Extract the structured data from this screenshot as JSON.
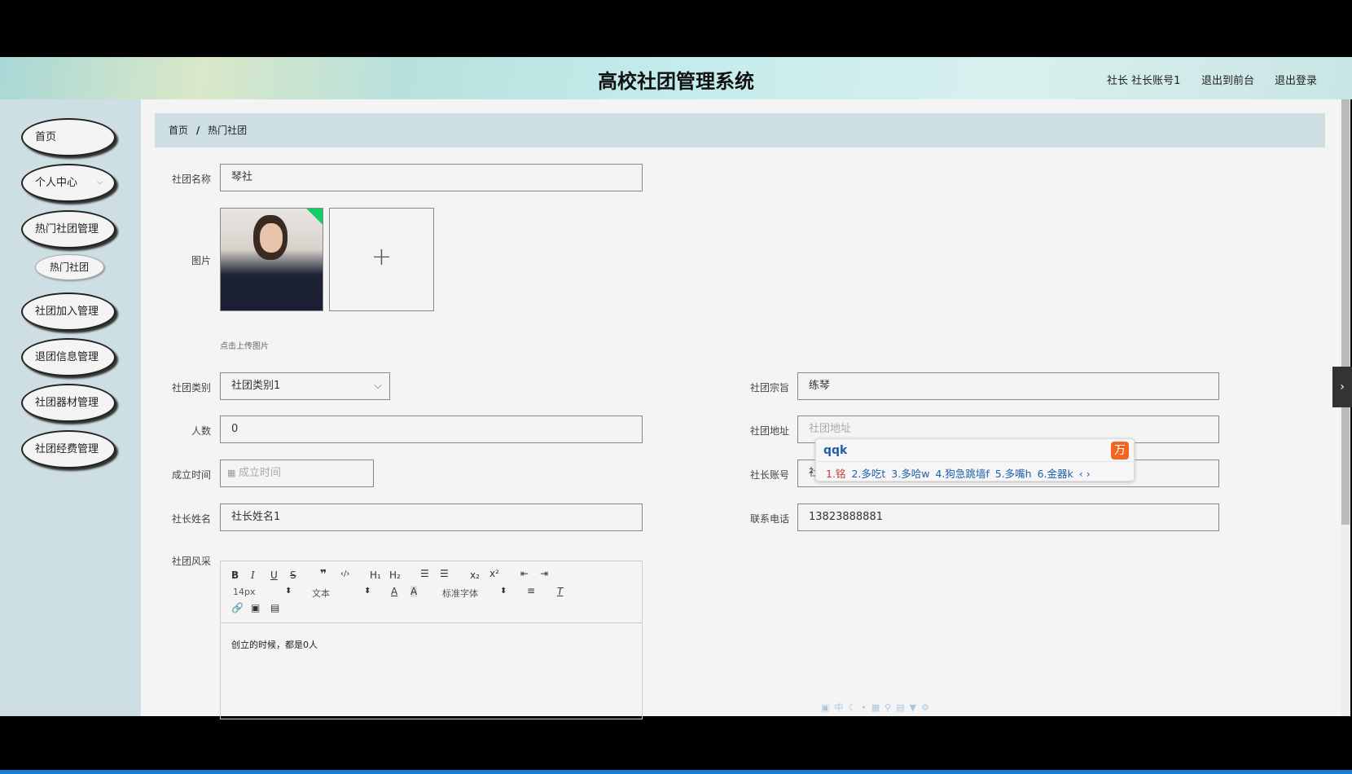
{
  "header": {
    "title": "高校社团管理系统",
    "user": "社长 社长账号1",
    "to_front": "退出到前台",
    "logout": "退出登录"
  },
  "sidebar": {
    "items": [
      {
        "label": "首页"
      },
      {
        "label": "个人中心"
      },
      {
        "label": "热门社团管理"
      },
      {
        "label": "热门社团"
      },
      {
        "label": "社团加入管理"
      },
      {
        "label": "退团信息管理"
      },
      {
        "label": "社团器材管理"
      },
      {
        "label": "社团经费管理"
      }
    ]
  },
  "breadcrumb": {
    "home": "首页",
    "sep": "/",
    "current": "热门社团"
  },
  "form": {
    "name_label": "社团名称",
    "name_value": "琴社",
    "image_label": "图片",
    "upload_hint": "点击上传图片",
    "plus": "+",
    "category_label": "社团类别",
    "category_value": "社团类别1",
    "purpose_label": "社团宗旨",
    "purpose_value": "练琴",
    "count_label": "人数",
    "count_value": "0",
    "address_label": "社团地址",
    "address_placeholder": "社团地址",
    "date_label": "成立时间",
    "date_placeholder": "成立时间",
    "account_label": "社长账号",
    "account_value": "社",
    "leader_label": "社长姓名",
    "leader_value": "社长姓名1",
    "phone_label": "联系电话",
    "phone_value": "13823888881",
    "style_label": "社团风采",
    "editor": {
      "font_size": "14px",
      "header": "文本",
      "font": "标准字体",
      "content": "创立的时候，都是0人"
    }
  },
  "ime": {
    "input": "qqk",
    "candidates": [
      "1.铭",
      "2.多吃t",
      "3.多哈w",
      "4.狗急跳墙f",
      "5.多嘴h",
      "6.金器k"
    ]
  }
}
